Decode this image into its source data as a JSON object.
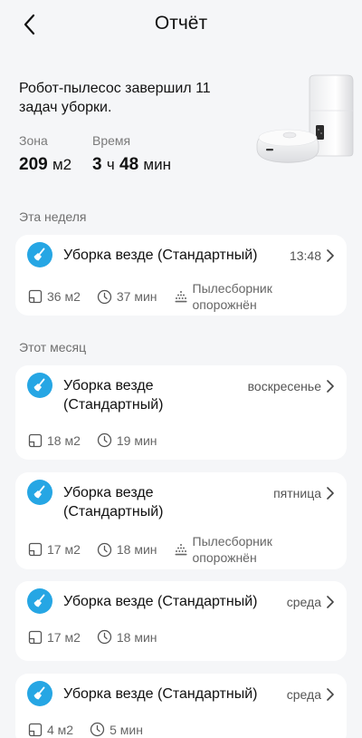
{
  "header": {
    "title": "Отчёт",
    "back_icon": "chevron-left-icon"
  },
  "summary": {
    "text": "Робот-пылесос завершил 11 задач уборки.",
    "area_label": "Зона",
    "area_value": "209",
    "area_unit": "м2",
    "time_label": "Время",
    "time_hours": "3",
    "time_hours_unit": "ч",
    "time_minutes": "48",
    "time_minutes_unit": "мин"
  },
  "sections": {
    "this_week": "Эта неделя",
    "this_month": "Этот месяц"
  },
  "records": [
    {
      "title": "Уборка везде (Стандартный)",
      "when": "13:48",
      "area": "36 м2",
      "duration": "37 мин",
      "dust": "Пылесборник опорожнён"
    },
    {
      "title": "Уборка везде (Стандартный)",
      "when": "воскресенье",
      "area": "18 м2",
      "duration": "19 мин",
      "dust": ""
    },
    {
      "title": "Уборка везде (Стандартный)",
      "when": "пятница",
      "area": "17 м2",
      "duration": "18 мин",
      "dust": "Пылесборник опорожнён"
    },
    {
      "title": "Уборка везде (Стандартный)",
      "when": "среда",
      "area": "17 м2",
      "duration": "18 мин",
      "dust": ""
    },
    {
      "title": "Уборка везде (Стандартный)",
      "when": "среда",
      "area": "4 м2",
      "duration": "5 мин",
      "dust": ""
    }
  ],
  "colors": {
    "accent": "#26a6e4",
    "background": "#f5f6f8",
    "card": "#ffffff"
  },
  "icons": {
    "mode": "broom-icon",
    "area": "area-icon",
    "duration": "clock-icon",
    "dust": "dust-icon",
    "chevron": "chevron-right-icon"
  }
}
